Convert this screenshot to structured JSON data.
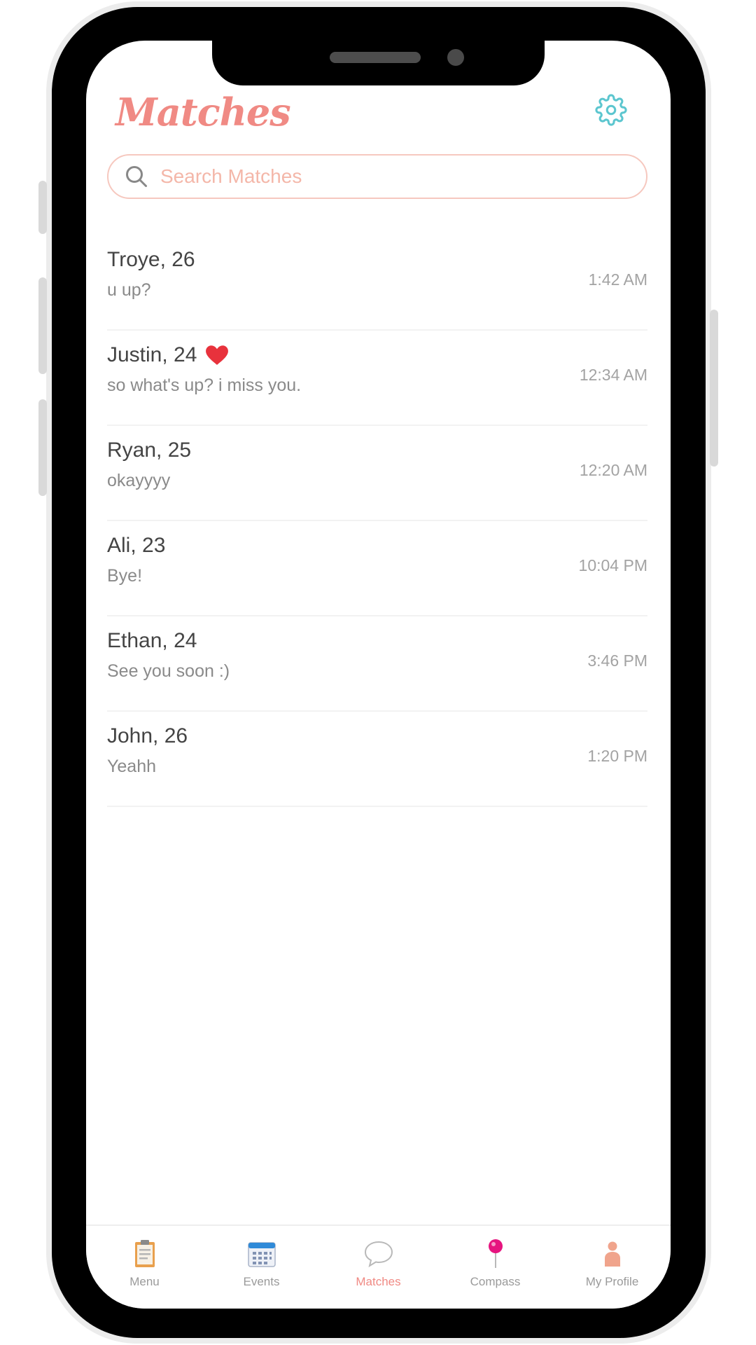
{
  "header": {
    "title": "Matches",
    "settings_icon": "gear-icon"
  },
  "search": {
    "placeholder": "Search Matches",
    "value": ""
  },
  "matches": [
    {
      "name": "Troye, 26",
      "message": "u up?",
      "time": "1:42 AM",
      "favorite": false
    },
    {
      "name": "Justin, 24",
      "message": "so what's up? i miss you.",
      "time": "12:34 AM",
      "favorite": true
    },
    {
      "name": "Ryan, 25",
      "message": "okayyyy",
      "time": "12:20 AM",
      "favorite": false
    },
    {
      "name": "Ali, 23",
      "message": "Bye!",
      "time": "10:04 PM",
      "favorite": false
    },
    {
      "name": "Ethan, 24",
      "message": "See you soon :)",
      "time": "3:46 PM",
      "favorite": false
    },
    {
      "name": "John, 26",
      "message": "Yeahh",
      "time": "1:20 PM",
      "favorite": false
    }
  ],
  "tabbar": {
    "items": [
      {
        "label": "Menu",
        "icon": "clipboard-icon"
      },
      {
        "label": "Events",
        "icon": "calendar-icon"
      },
      {
        "label": "Matches",
        "icon": "chat-bubble-icon",
        "active": true
      },
      {
        "label": "Compass",
        "icon": "map-pin-icon"
      },
      {
        "label": "My Profile",
        "icon": "person-icon"
      }
    ]
  },
  "colors": {
    "accent": "#f08a84",
    "gear": "#5cc6cf",
    "heart": "#e8323c",
    "search_border": "#f6c8bf",
    "pin": "#e6147f"
  }
}
